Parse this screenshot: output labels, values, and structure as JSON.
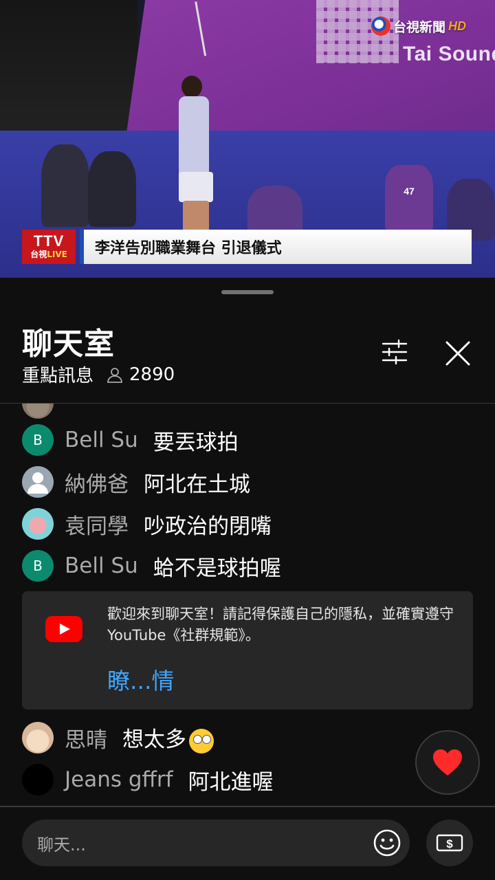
{
  "video": {
    "channel_logo_text": "台視新聞",
    "channel_logo_hd": "HD",
    "sponsor_text": "Tai Sound",
    "photographer_bib": "47",
    "broadcaster": {
      "name": "TTV",
      "sub_prefix": "台視",
      "sub_live": "LIVE"
    },
    "headline": "李洋告別職業舞台 引退儀式"
  },
  "chat": {
    "title": "聊天室",
    "mode": "重點訊息",
    "viewer_count": "2890",
    "messages": [
      {
        "author": "Bell Su",
        "text": "要丟球拍",
        "avatar_initial": "B",
        "avatar_color": "#0b8a6e"
      },
      {
        "author": "納佛爸",
        "text": "阿北在土城",
        "avatar_initial": "",
        "avatar_color": "#9aa6b2"
      },
      {
        "author": "袁同學",
        "text": "吵政治的閉嘴",
        "avatar_initial": "",
        "avatar_color": "#7fd3d8"
      },
      {
        "author": "Bell Su",
        "text": "蛤不是球拍喔",
        "avatar_initial": "B",
        "avatar_color": "#0b8a6e"
      }
    ],
    "welcome": {
      "text": "歡迎來到聊天室！請記得保護自己的隱私，並確實遵守 YouTube《社群規範》。",
      "link_label": "瞭...情"
    },
    "messages_after": [
      {
        "author": "思晴",
        "text": "想太多",
        "emoji": "face-with-rolling-eyes",
        "avatar_color": "#d8b89a"
      },
      {
        "author": "Jeans gffrf",
        "text": "阿北進喔",
        "avatar_color": "#000000"
      }
    ],
    "input_placeholder": "聊天...",
    "accent_link_color": "#3ea6ff",
    "heart_color": "#ff2a2a"
  }
}
